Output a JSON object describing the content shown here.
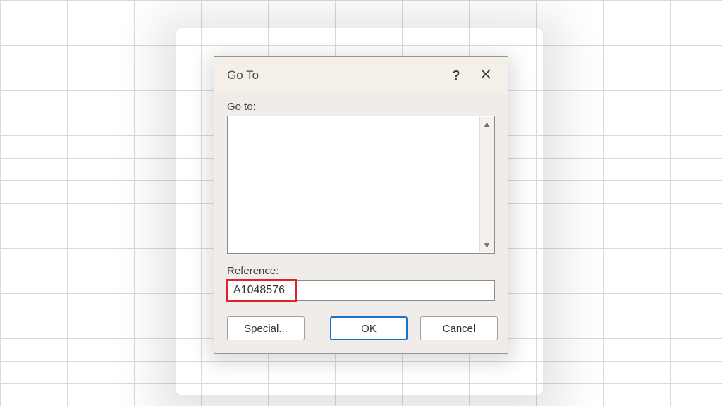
{
  "dialog": {
    "title": "Go To",
    "help_symbol": "?",
    "close_name": "close",
    "goto_label": "Go to:",
    "reference_label": "Reference:",
    "reference_value": "A1048576",
    "buttons": {
      "special_prefix": "S",
      "special_rest": "pecial...",
      "ok": "OK",
      "cancel": "Cancel"
    }
  }
}
